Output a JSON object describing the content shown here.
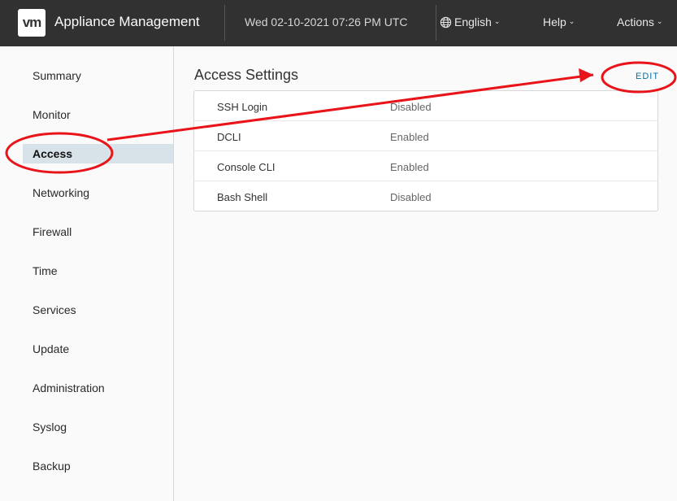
{
  "header": {
    "logo_text": "vm",
    "app_title": "Appliance Management",
    "datetime": "Wed 02-10-2021 07:26 PM UTC",
    "language": "English",
    "help": "Help",
    "actions": "Actions"
  },
  "sidebar": {
    "items": [
      {
        "label": "Summary"
      },
      {
        "label": "Monitor"
      },
      {
        "label": "Access",
        "active": true
      },
      {
        "label": "Networking"
      },
      {
        "label": "Firewall"
      },
      {
        "label": "Time"
      },
      {
        "label": "Services"
      },
      {
        "label": "Update"
      },
      {
        "label": "Administration"
      },
      {
        "label": "Syslog"
      },
      {
        "label": "Backup"
      }
    ]
  },
  "main": {
    "title": "Access Settings",
    "edit_label": "EDIT",
    "rows": [
      {
        "key": "SSH Login",
        "value": "Disabled"
      },
      {
        "key": "DCLI",
        "value": "Enabled"
      },
      {
        "key": "Console CLI",
        "value": "Enabled"
      },
      {
        "key": "Bash Shell",
        "value": "Disabled"
      }
    ]
  },
  "annotation": {
    "color": "#e8141a"
  },
  "colors": {
    "header_bg": "#313131",
    "accent_link": "#0072a3",
    "active_nav_bg": "#d8e3e9"
  }
}
